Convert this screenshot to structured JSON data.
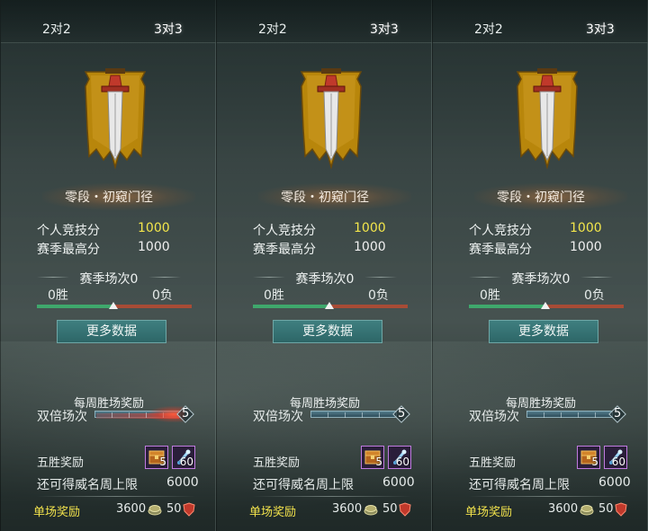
{
  "colors": {
    "gold_text": "#f3e64b",
    "win_green": "#3fa86c",
    "loss_red": "#a84c36",
    "button_teal": "#2d6667",
    "reward_label": "#f1e24c"
  },
  "panels": [
    {
      "tabs": {
        "left": "2对2",
        "right": "3对3"
      },
      "active_tab": "right",
      "emblem_icon": "sword-banner-icon",
      "rank_name": "零段・初窥门径",
      "personal_score_label": "个人竞技分",
      "personal_score_value": "1000",
      "season_high_label": "赛季最高分",
      "season_high_value": "1000",
      "season_matches": "赛季场次0",
      "wins": "0胜",
      "losses": "0负",
      "win_ratio": 0.5,
      "more_data_button": "更多数据",
      "weekly_title": "每周胜场奖励",
      "double_label": "双倍场次",
      "double_value": "5",
      "double_glow": true,
      "five_win_label": "五胜奖励",
      "chest_qty": "5",
      "scroll_qty": "60",
      "limit_label": "还可得威名周上限",
      "limit_value": "6000",
      "single_label": "单场奖励",
      "single_coin": "3600",
      "single_shield": "50"
    },
    {
      "tabs": {
        "left": "2对2",
        "right": "3对3"
      },
      "active_tab": "right",
      "emblem_icon": "sword-banner-icon",
      "rank_name": "零段・初窥门径",
      "personal_score_label": "个人竞技分",
      "personal_score_value": "1000",
      "season_high_label": "赛季最高分",
      "season_high_value": "1000",
      "season_matches": "赛季场次0",
      "wins": "0胜",
      "losses": "0负",
      "win_ratio": 0.5,
      "more_data_button": "更多数据",
      "weekly_title": "每周胜场奖励",
      "double_label": "双倍场次",
      "double_value": "5",
      "double_glow": false,
      "five_win_label": "五胜奖励",
      "chest_qty": "5",
      "scroll_qty": "60",
      "limit_label": "还可得威名周上限",
      "limit_value": "6000",
      "single_label": "单场奖励",
      "single_coin": "3600",
      "single_shield": "50"
    },
    {
      "tabs": {
        "left": "2对2",
        "right": "3对3"
      },
      "active_tab": "right",
      "emblem_icon": "sword-banner-icon",
      "rank_name": "零段・初窥门径",
      "personal_score_label": "个人竞技分",
      "personal_score_value": "1000",
      "season_high_label": "赛季最高分",
      "season_high_value": "1000",
      "season_matches": "赛季场次0",
      "wins": "0胜",
      "losses": "0负",
      "win_ratio": 0.5,
      "more_data_button": "更多数据",
      "weekly_title": "每周胜场奖励",
      "double_label": "双倍场次",
      "double_value": "5",
      "double_glow": false,
      "five_win_label": "五胜奖励",
      "chest_qty": "5",
      "scroll_qty": "60",
      "limit_label": "还可得威名周上限",
      "limit_value": "6000",
      "single_label": "单场奖励",
      "single_coin": "3600",
      "single_shield": "50"
    }
  ]
}
